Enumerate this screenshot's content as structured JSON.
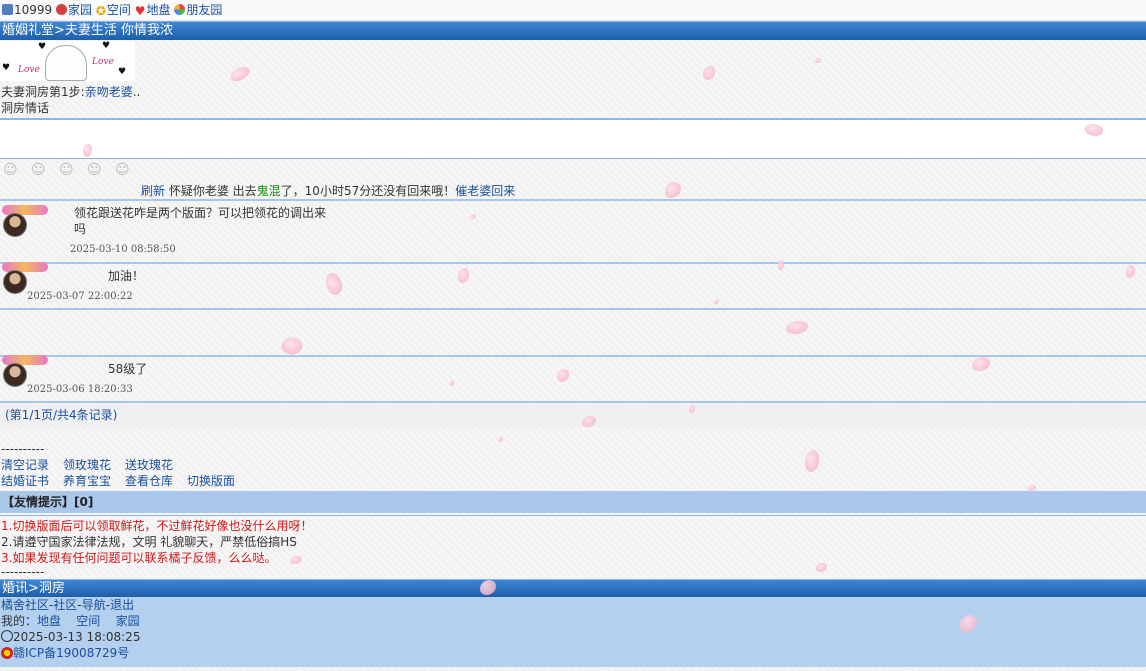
{
  "topbar": {
    "coins": "10999",
    "links": [
      "家园",
      "空间",
      "地盘",
      "朋友园"
    ],
    "icons": [
      "coin-icon",
      "home-icon",
      "star-icon",
      "heart-icon",
      "friends-icon"
    ]
  },
  "header": {
    "title": "婚姻礼堂>夫妻生活 你情我浓"
  },
  "banner": {
    "love_a": "Love",
    "love_b": "Love"
  },
  "step": {
    "prefix": "夫妻洞房第1步:",
    "action": "亲吻老婆",
    "suffix": ".."
  },
  "section_label": "洞房情话",
  "chat": {
    "value": "",
    "placeholder": ""
  },
  "smileys": [
    "☺",
    "☺",
    "☺",
    "☺",
    "☺"
  ],
  "status": {
    "refresh": "刷新",
    "text_a": " 怀疑你老婆 出去",
    "green": "鬼混",
    "text_b": "了，10小时57分还没有回来哦！",
    "call": "催老婆回来"
  },
  "posts": [
    {
      "message": "领花跟送花咋是两个版面？可以把领花的调出来吗",
      "time": "2025-03-10 08:58:50"
    },
    {
      "message": "加油！",
      "time": "2025-03-07 22:00:22"
    },
    {
      "message": "",
      "time": ""
    },
    {
      "message": "58级了",
      "time": "2025-03-06 18:20:33"
    }
  ],
  "pager": "(第1/1页/共4条记录)",
  "divider": "----------",
  "menu_row1": [
    "清空记录",
    "领玫瑰花",
    "送玫瑰花"
  ],
  "menu_row2": [
    "结婚证书",
    "养育宝宝",
    "查看仓库",
    "切换版面"
  ],
  "tips": {
    "head": "【友情提示】[0]",
    "items": [
      "1.切换版面后可以领取鲜花，不过鲜花好像也没什么用呀！",
      "2.请遵守国家法律法规，文明 礼貌聊天，严禁低俗搞HS",
      "3.如果发现有任何问题可以联系橘子反馈，么么哒。"
    ]
  },
  "footer": {
    "bar": "婚讯>洞房",
    "nav": [
      "橘舍社区",
      "社区",
      "导航",
      "退出"
    ],
    "mine_label": "我的：",
    "mine": [
      "地盘",
      "空间",
      "家园"
    ],
    "datetime": "2025-03-13 18:08:25",
    "icp": "赣ICP备19008729号"
  },
  "colors": {
    "link": "#1a4f9c",
    "title_bar": "#1f5ea8",
    "tip_red": "#d01818",
    "footer_bg": "#b3d0ee"
  }
}
